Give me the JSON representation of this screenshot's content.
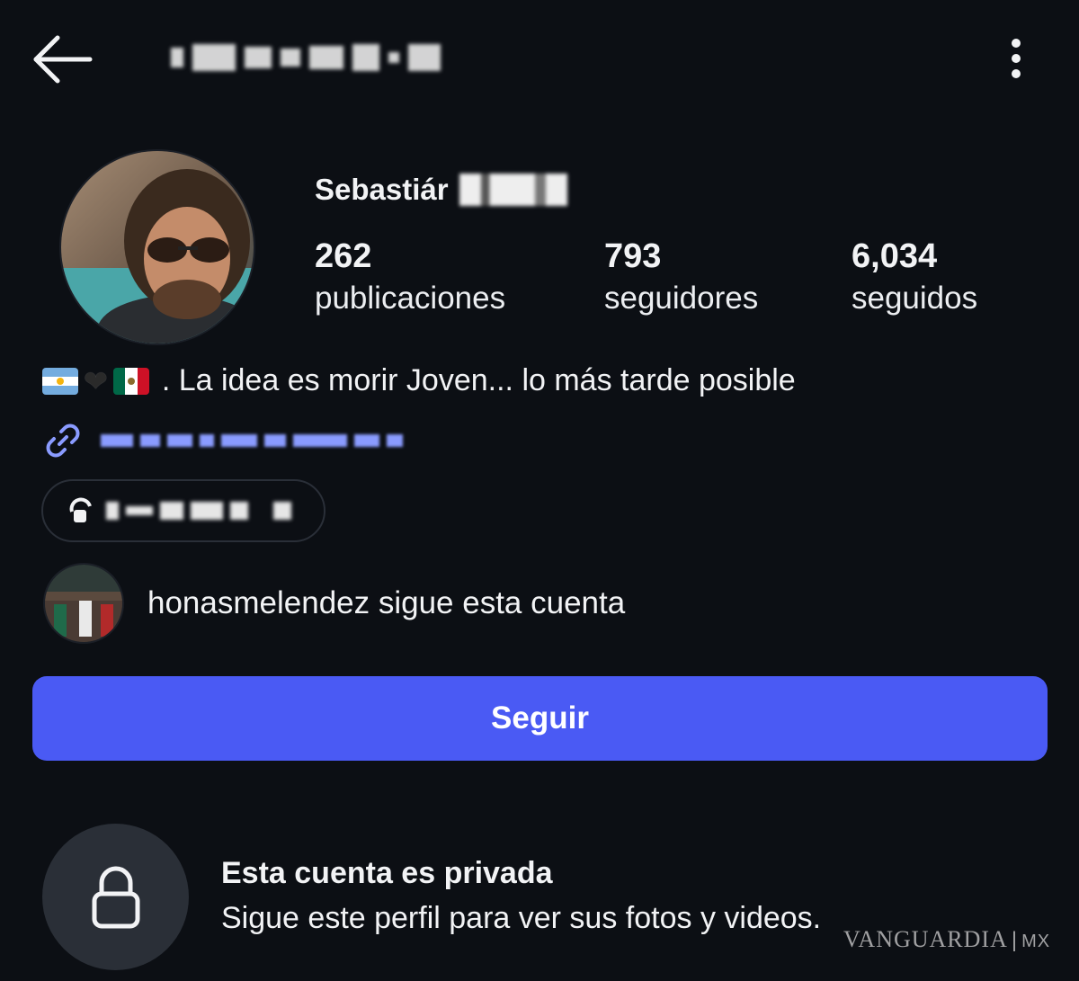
{
  "topbar": {
    "back_icon": "arrow-left-icon",
    "more_icon": "more-vertical-icon"
  },
  "profile": {
    "display_name_visible": "Sebastiár",
    "stats": [
      {
        "value": "262",
        "label": "publicaciones"
      },
      {
        "value": "793",
        "label": "seguidores"
      },
      {
        "value": "6,034",
        "label": "seguidos"
      }
    ],
    "bio": {
      "flags": [
        "argentina-flag",
        "black-heart",
        "mexico-flag"
      ],
      "text": ". La idea es morir Joven... lo más tarde posible"
    },
    "link_icon": "link-icon",
    "threads_icon": "threads-icon"
  },
  "followed_by": {
    "text": "honasmelendez sigue esta cuenta"
  },
  "actions": {
    "follow_label": "Seguir",
    "accent_color": "#4a5af4"
  },
  "private_notice": {
    "title": "Esta cuenta es privada",
    "subtitle": "Sigue este perfil para ver sus fotos y videos.",
    "icon": "lock-icon"
  },
  "watermark": {
    "brand": "VANGUARDIA",
    "separator": "|",
    "country": "MX"
  }
}
